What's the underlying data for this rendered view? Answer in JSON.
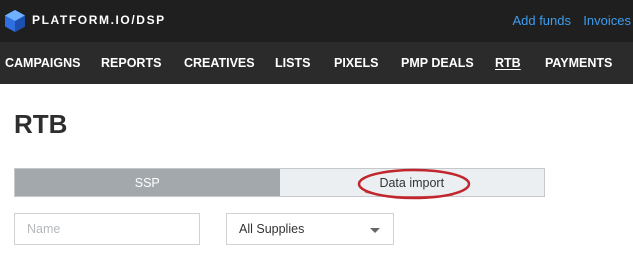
{
  "topbar": {
    "logo_text": "PLATFORM.IO/DSP",
    "links": {
      "add_funds": "Add funds",
      "invoices": "Invoices"
    }
  },
  "nav": {
    "items": [
      {
        "label": "CAMPAIGNS",
        "active": false
      },
      {
        "label": "REPORTS",
        "active": false
      },
      {
        "label": "CREATIVES",
        "active": false
      },
      {
        "label": "LISTS",
        "active": false
      },
      {
        "label": "PIXELS",
        "active": false
      },
      {
        "label": "PMP DEALS",
        "active": false
      },
      {
        "label": "RTB",
        "active": true
      },
      {
        "label": "PAYMENTS",
        "active": false
      }
    ]
  },
  "page": {
    "title": "RTB"
  },
  "segment": {
    "ssp": "SSP",
    "data_import": "Data import",
    "selected": "SSP"
  },
  "filters": {
    "name_placeholder": "Name",
    "supplies_value": "All Supplies"
  },
  "colors": {
    "topbar_bg": "#1f1f1f",
    "nav_bg": "#2b2b2b",
    "link": "#3d9cf0",
    "segment_active": "#a3a8ac",
    "segment_inactive": "#eceff1",
    "annotation": "#c0262d"
  }
}
